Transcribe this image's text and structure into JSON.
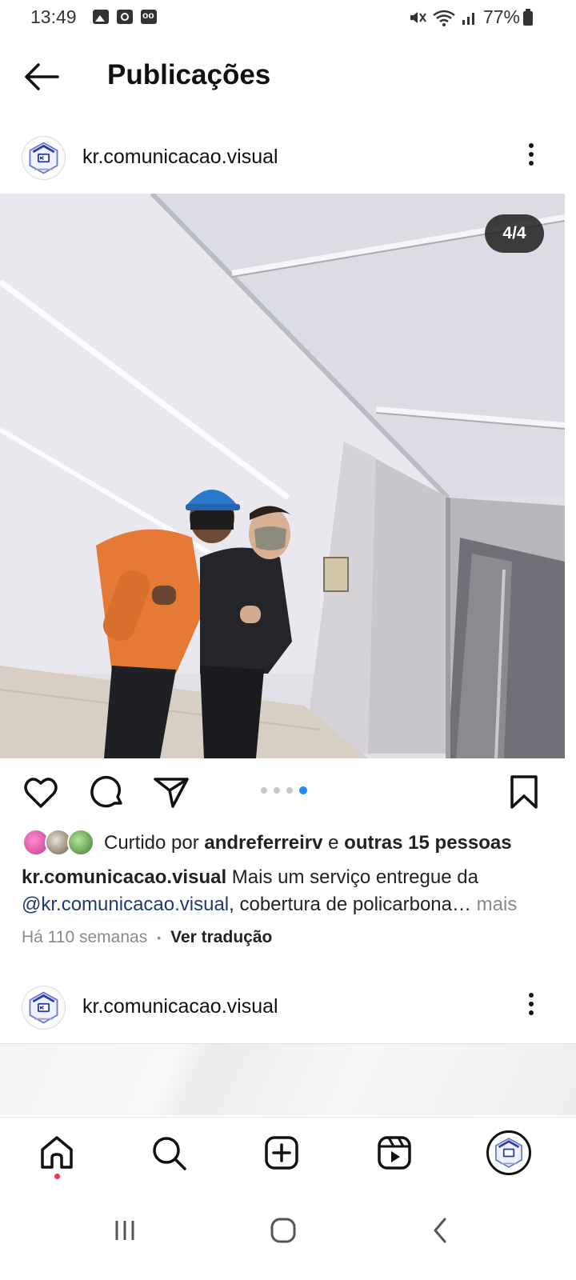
{
  "status_bar": {
    "time": "13:49",
    "battery": "77%",
    "icons": [
      "image-icon",
      "clock-icon",
      "voicemail-icon",
      "mute-icon",
      "wifi-icon",
      "signal-icon",
      "battery-icon"
    ]
  },
  "header": {
    "title": "Publicações"
  },
  "post": {
    "username": "kr.comunicacao.visual",
    "counter": "4/4",
    "carousel": {
      "total": 4,
      "current": 4
    },
    "likes_prefix": "Curtido por ",
    "likes_user": "andreferreirv",
    "likes_middle": " e ",
    "likes_rest": "outras 15 pessoas",
    "caption_user": "kr.comunicacao.visual",
    "caption_text": " Mais um serviço entregue da ",
    "caption_mention": "@kr.comunicacao.visual",
    "caption_text2": ", cobertura de policarbona…",
    "caption_more": " mais",
    "time_ago": "Há 110 semanas",
    "translate": "Ver tradução"
  },
  "next_post": {
    "username": "kr.comunicacao.visual"
  },
  "colors": {
    "accent_blue": "#1a8cff",
    "notification_red": "#ff2f52",
    "mention_blue": "#1d3b72"
  }
}
